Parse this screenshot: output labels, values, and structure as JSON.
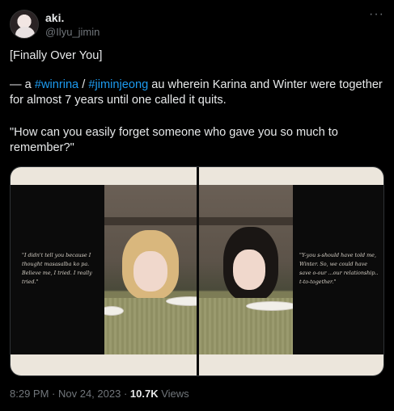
{
  "user": {
    "display_name": "aki.",
    "handle": "@Ilyu_jimin",
    "more_label": "···"
  },
  "tweet": {
    "line1": "[Finally Over You]",
    "line2_prefix": "— a ",
    "hashtag1": "#winrina",
    "separator": " / ",
    "hashtag2": "#jiminjeong",
    "line2_suffix": " au wherein Karina and Winter were together for almost 7 years until one called it quits.",
    "line3": "\"How can you easily forget someone who gave you so much to remember?\""
  },
  "media": {
    "left_quote": "\"I didn't tell you because I thought masasalba ko pa. Believe me, I tried. I really tried.\"",
    "right_quote": "\"Y-you s-should have told me, Winter. So, we could have save o-our ...our relationship.. t-to-together.\""
  },
  "meta": {
    "time": "8:29 PM",
    "dot1": " · ",
    "date": "Nov 24, 2023",
    "dot2": " · ",
    "views_count": "10.7K",
    "views_label": " Views"
  },
  "colors": {
    "link": "#1d9bf0",
    "text": "#e7e9ea",
    "muted": "#71767b",
    "background": "#000000"
  }
}
